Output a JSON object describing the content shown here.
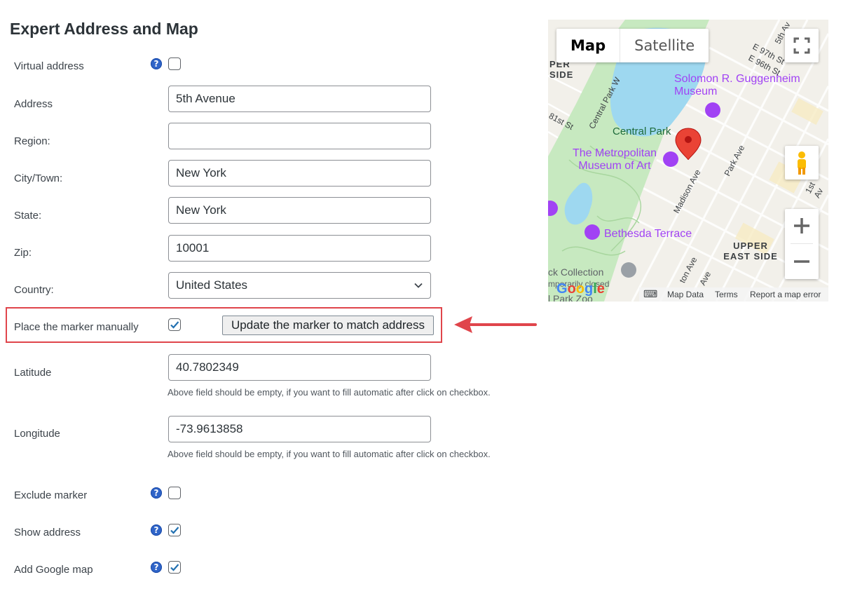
{
  "page": {
    "title": "Expert Address and Map"
  },
  "form": {
    "virtual_address": {
      "label": "Virtual address",
      "checked": false
    },
    "address": {
      "label": "Address",
      "value": "5th Avenue"
    },
    "region": {
      "label": "Region:",
      "value": ""
    },
    "city": {
      "label": "City/Town:",
      "value": "New York"
    },
    "state": {
      "label": "State:",
      "value": "New York"
    },
    "zip": {
      "label": "Zip:",
      "value": "10001"
    },
    "country": {
      "label": "Country:",
      "value": "United States"
    },
    "place_marker": {
      "label": "Place the marker manually",
      "checked": true
    },
    "update_button": "Update the marker to match address",
    "latitude": {
      "label": "Latitude",
      "value": "40.7802349",
      "hint": "Above field should be empty, if you want to fill automatic after click on checkbox."
    },
    "longitude": {
      "label": "Longitude",
      "value": "-73.9613858",
      "hint": "Above field should be empty, if you want to fill automatic after click on checkbox."
    },
    "exclude_marker": {
      "label": "Exclude marker",
      "checked": false
    },
    "show_address": {
      "label": "Show address",
      "checked": true
    },
    "add_google_map": {
      "label": "Add Google map",
      "checked": true
    },
    "help_icon": "?"
  },
  "map": {
    "type_tabs": [
      "Map",
      "Satellite"
    ],
    "active_tab": "Map",
    "pois": {
      "guggenheim": "Solomon R. Guggenheim Museum",
      "met": "The Metropolitan Museum of Art",
      "bethesda": "Bethesda Terrace",
      "collection": "ck Collection",
      "collection_status": "mporarily closed",
      "zoo": "l Park Zoo"
    },
    "park_label": "Central Park",
    "area_labels": {
      "upper_east": "UPPER EAST SIDE",
      "upper_west": "PER SIDE"
    },
    "streets": [
      "E 97th St",
      "E 96th St",
      "5th Av",
      "Central Park W",
      "81st St",
      "Madison Ave",
      "Park Ave",
      "1st Av",
      "ton Ave",
      "Ave"
    ],
    "footer": {
      "keyboard": "⌨",
      "map_data": "Map Data",
      "terms": "Terms",
      "report": "Report a map error"
    },
    "logo": "Google",
    "colors": {
      "water": "#9ed8f0",
      "park": "#c7e9c0",
      "marker": "#ea4335",
      "poi": "#a142f4"
    }
  },
  "colors": {
    "highlight": "#e0454b",
    "help_icon": "#2f64c8"
  }
}
